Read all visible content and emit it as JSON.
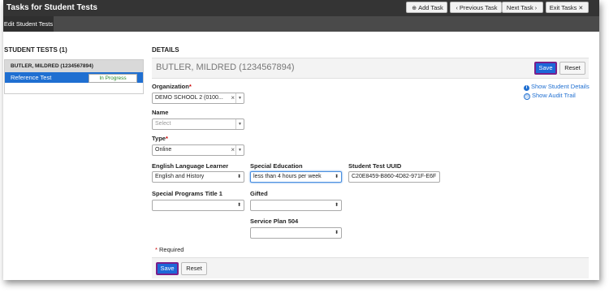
{
  "app": {
    "title": "Tasks for Student Tests"
  },
  "toolbar": {
    "add_task": "Add Task",
    "previous_task": "Previous Task",
    "next_task": "Next Task",
    "exit_tasks": "Exit Tasks"
  },
  "subnav": {
    "tab": "Edit Student Tests"
  },
  "left": {
    "heading": "STUDENT TESTS (1)",
    "student": "BUTLER, MILDRED (1234567894)",
    "test": {
      "name": "Reference Test",
      "status": "In Progress"
    }
  },
  "details": {
    "heading": "DETAILS",
    "student_name": "BUTLER, MILDRED (1234567894)",
    "save_label": "Save",
    "reset_label": "Reset",
    "show_student_details": "Show Student Details",
    "show_audit_trail": "Show Audit Trail",
    "organization": {
      "label": "Organization",
      "required": "*",
      "value": "DEMO SCHOOL 2 (0100..."
    },
    "name": {
      "label": "Name",
      "placeholder": "Select"
    },
    "type": {
      "label": "Type",
      "required": "*",
      "value": "Online"
    },
    "ell": {
      "label": "English Language Learner",
      "value": "English and History"
    },
    "special_education": {
      "label": "Special Education",
      "value": "less than 4 hours per week"
    },
    "uuid": {
      "label": "Student Test UUID",
      "value": "C20E8459-B860-4D82-971F-E6F"
    },
    "special_programs": {
      "label": "Special Programs Title 1",
      "value": ""
    },
    "gifted": {
      "label": "Gifted",
      "value": ""
    },
    "service_plan": {
      "label": "Service Plan 504",
      "value": ""
    },
    "required_note": "Required",
    "required_star": "*"
  },
  "icons": [
    "plus-circle-icon",
    "chevron-left-icon",
    "chevron-right-icon",
    "close-icon",
    "info-icon",
    "clock-icon",
    "chevron-down-icon",
    "clear-icon",
    "updown-icon"
  ]
}
